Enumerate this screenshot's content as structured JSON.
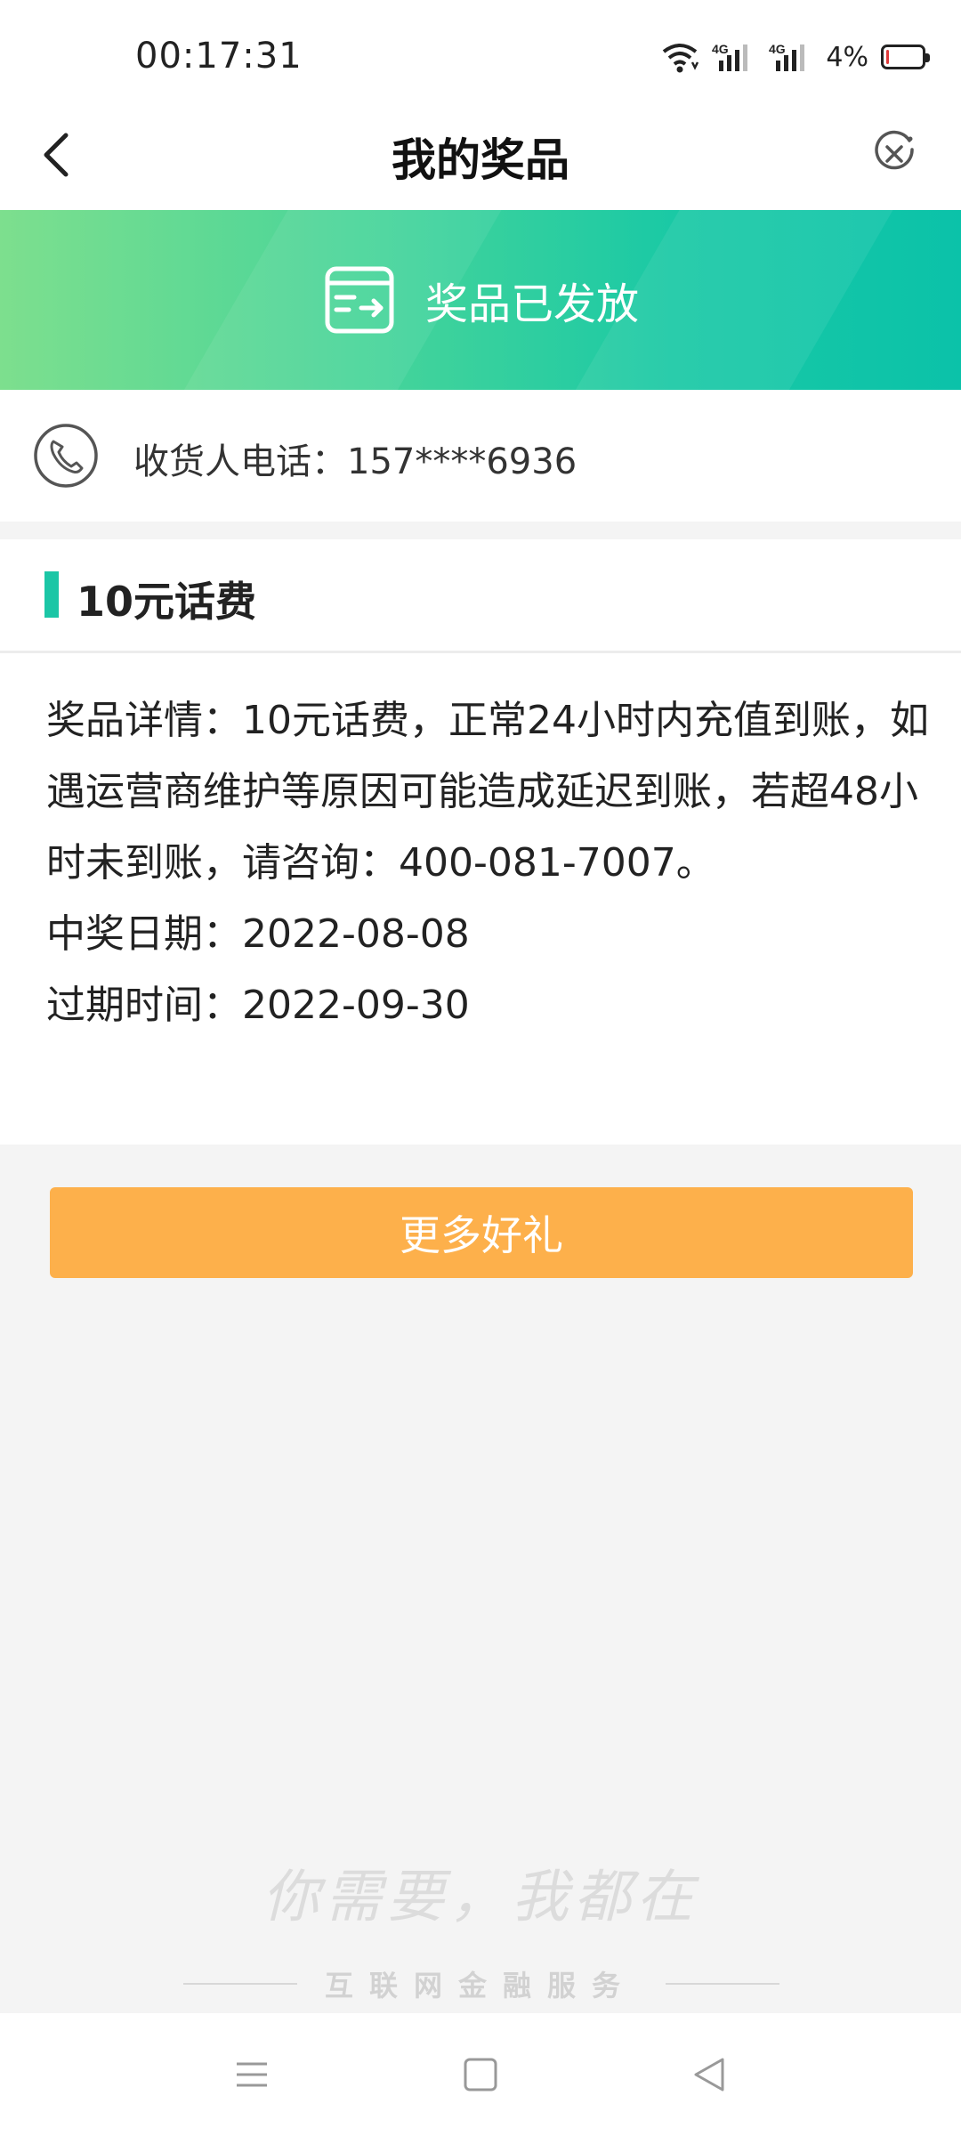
{
  "status_bar": {
    "time": "00:17:31",
    "battery": "4%",
    "icons": [
      "wifi-icon",
      "signal-4g-icon",
      "signal-4g-icon",
      "battery-icon"
    ]
  },
  "nav": {
    "title": "我的奖品",
    "back_icon": "chevron-left-icon",
    "close_icon": "close-circle-icon"
  },
  "banner": {
    "text": "奖品已发放",
    "icon": "delivery-card-icon"
  },
  "receiver": {
    "icon": "phone-icon",
    "label": "收货人电话：157****6936"
  },
  "prize": {
    "title": "10元话费",
    "details": "奖品详情：10元话费，正常24小时内充值到账，如遇运营商维护等原因可能造成延迟到账，若超48小时未到账，请咨询：400-081-7007。",
    "win_date": "中奖日期：2022-08-08",
    "expire_date": "过期时间：2022-09-30",
    "accent_color": "#1bc6a6"
  },
  "actions": {
    "more_gifts": "更多好礼",
    "button_color": "#fdb04b"
  },
  "watermark": {
    "slogan": "你需要，我都在",
    "subtitle": "互联网金融服务"
  },
  "system_nav": {
    "icons": [
      "menu-icon",
      "home-square-icon",
      "back-triangle-icon"
    ]
  }
}
